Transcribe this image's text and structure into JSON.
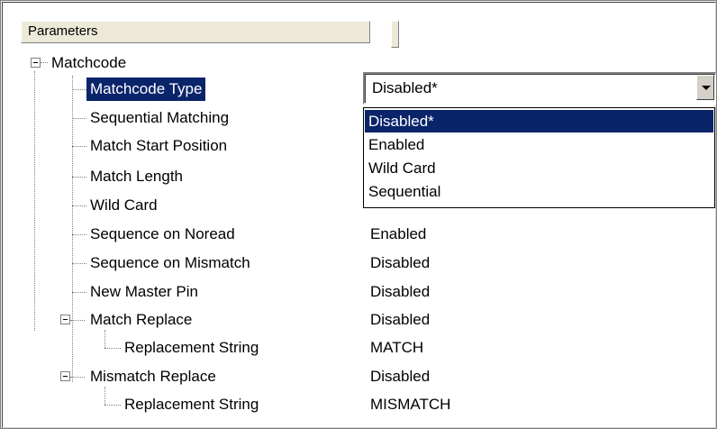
{
  "header": {
    "parameters_label": "Parameters",
    "value_label": ""
  },
  "tree": {
    "root": {
      "label": "Matchcode"
    },
    "items": [
      {
        "label": "Matchcode Type",
        "value": ""
      },
      {
        "label": "Sequential Matching",
        "value": ""
      },
      {
        "label": "Match Start Position",
        "value": ""
      },
      {
        "label": "Match Length",
        "value": ""
      },
      {
        "label": "Wild Card",
        "value": ""
      },
      {
        "label": "Sequence on Noread",
        "value": "Enabled"
      },
      {
        "label": "Sequence on Mismatch",
        "value": "Disabled"
      },
      {
        "label": "New Master Pin",
        "value": "Disabled"
      },
      {
        "label": "Match Replace",
        "value": "Disabled"
      },
      {
        "label": "Replacement String",
        "value": "MATCH"
      },
      {
        "label": "Mismatch Replace",
        "value": "Disabled"
      },
      {
        "label": "Replacement String",
        "value": "MISMATCH"
      }
    ]
  },
  "combo": {
    "selected_value": "Disabled*",
    "options": [
      "Disabled*",
      "Enabled",
      "Wild Card",
      "Sequential"
    ],
    "highlighted_index": 0
  },
  "colors": {
    "selection": "#0a246a",
    "header_bg": "#ece9d8"
  },
  "icons": {
    "expander": "collapse-minus-icon",
    "combo_arrow": "chevron-down-icon"
  }
}
